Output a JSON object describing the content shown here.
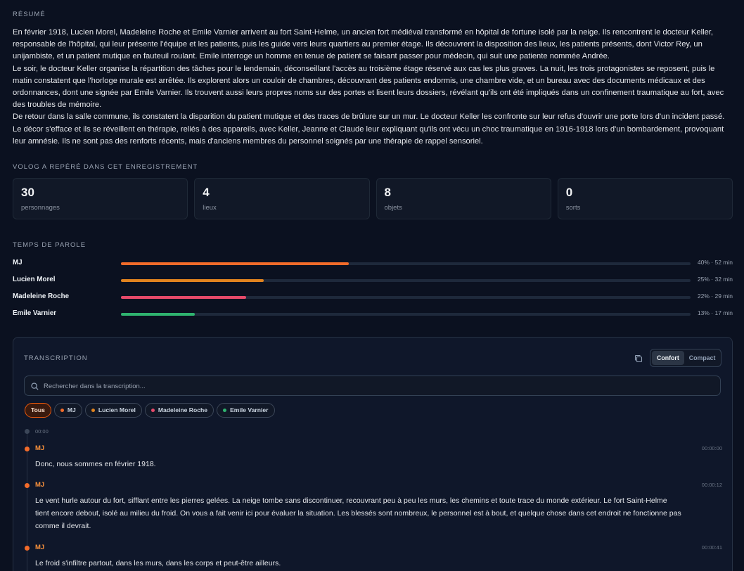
{
  "summary": {
    "label": "RÉSUMÉ",
    "paragraphs": [
      "En février 1918, Lucien Morel, Madeleine Roche et Emile Varnier arrivent au fort Saint-Helme, un ancien fort médiéval transformé en hôpital de fortune isolé par la neige. Ils rencontrent le docteur Keller, responsable de l'hôpital, qui leur présente l'équipe et les patients, puis les guide vers leurs quartiers au premier étage. Ils découvrent la disposition des lieux, les patients présents, dont Victor Rey, un unijambiste, et un patient mutique en fauteuil roulant. Emile interroge un homme en tenue de patient se faisant passer pour médecin, qui suit une patiente nommée Andrée.",
      "Le soir, le docteur Keller organise la répartition des tâches pour le lendemain, déconseillant l'accès au troisième étage réservé aux cas les plus graves. La nuit, les trois protagonistes se reposent, puis le matin constatent que l'horloge murale est arrêtée. Ils explorent alors un couloir de chambres, découvrant des patients endormis, une chambre vide, et un bureau avec des documents médicaux et des ordonnances, dont une signée par Emile Varnier. Ils trouvent aussi leurs propres noms sur des portes et lisent leurs dossiers, révélant qu'ils ont été impliqués dans un confinement traumatique au fort, avec des troubles de mémoire.",
      "De retour dans la salle commune, ils constatent la disparition du patient mutique et des traces de brûlure sur un mur. Le docteur Keller les confronte sur leur refus d'ouvrir une porte lors d'un incident passé. Le décor s'efface et ils se réveillent en thérapie, reliés à des appareils, avec Keller, Jeanne et Claude leur expliquant qu'ils ont vécu un choc traumatique en 1916-1918 lors d'un bombardement, provoquant leur amnésie. Ils ne sont pas des renforts récents, mais d'anciens membres du personnel soignés par une thérapie de rappel sensoriel."
    ]
  },
  "detected": {
    "label": "VOLOG A REPÉRÉ DANS CET ENREGISTREMENT",
    "stats": [
      {
        "value": "30",
        "label": "personnages"
      },
      {
        "value": "4",
        "label": "lieux"
      },
      {
        "value": "8",
        "label": "objets"
      },
      {
        "value": "0",
        "label": "sorts"
      }
    ]
  },
  "speaking": {
    "label": "TEMPS DE PAROLE",
    "speakers": [
      {
        "name": "MJ",
        "stat": "40% · 52 min",
        "fraction": 0.4,
        "color": "#f26b2a"
      },
      {
        "name": "Lucien Morel",
        "stat": "25% · 32 min",
        "fraction": 0.25,
        "color": "#e0831f"
      },
      {
        "name": "Madeleine Roche",
        "stat": "22% · 29 min",
        "fraction": 0.22,
        "color": "#e64a6a"
      },
      {
        "name": "Emile Varnier",
        "stat": "13% · 17 min",
        "fraction": 0.13,
        "color": "#2fb36f"
      }
    ]
  },
  "transcription": {
    "label": "TRANSCRIPTION",
    "view_modes": [
      "Confort",
      "Compact"
    ],
    "active_mode": "Confort",
    "search_placeholder": "Rechercher dans la transcription...",
    "filters": [
      {
        "label": "Tous",
        "color": null,
        "active": true
      },
      {
        "label": "MJ",
        "color": "#f26b2a",
        "active": false
      },
      {
        "label": "Lucien Morel",
        "color": "#e0831f",
        "active": false
      },
      {
        "label": "Madeleine Roche",
        "color": "#e64a6a",
        "active": false
      },
      {
        "label": "Emile Varnier",
        "color": "#2fb36f",
        "active": false
      }
    ],
    "start_time": "00:00",
    "entries": [
      {
        "speaker": "MJ",
        "time": "00:00:00",
        "text": "Donc, nous sommes en février 1918."
      },
      {
        "speaker": "MJ",
        "time": "00:00:12",
        "text": "Le vent hurle autour du fort, sifflant entre les pierres gelées. La neige tombe sans discontinuer, recouvrant peu à peu les murs, les chemins et toute trace du monde extérieur. Le fort Saint-Helme tient encore debout, isolé au milieu du froid. On vous a fait venir ici pour évaluer la situation. Les blessés sont nombreux, le personnel est à bout, et quelque chose dans cet endroit ne fonctionne pas comme il devrait."
      },
      {
        "speaker": "MJ",
        "time": "00:00:41",
        "text": "Le froid s'infiltre partout, dans les murs, dans les corps et peut-être ailleurs."
      }
    ]
  }
}
